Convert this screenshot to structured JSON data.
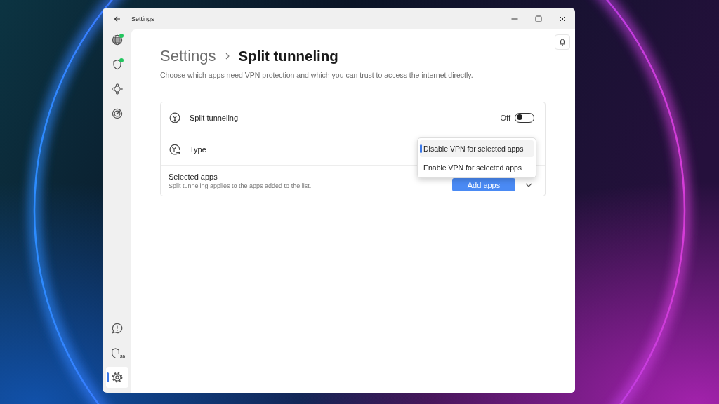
{
  "window": {
    "title": "Settings"
  },
  "sidebar": {
    "items": [
      {
        "kind": "globe",
        "indicator": true,
        "selected": false
      },
      {
        "kind": "shield",
        "indicator": true,
        "selected": false
      },
      {
        "kind": "nodes",
        "indicator": false,
        "selected": false
      },
      {
        "kind": "target",
        "indicator": false,
        "selected": false
      }
    ],
    "bottom_items": [
      {
        "kind": "help",
        "indicator": false,
        "selected": false
      },
      {
        "kind": "shield",
        "indicator": false,
        "badge": "80",
        "selected": false
      },
      {
        "kind": "settings",
        "indicator": false,
        "selected": true
      }
    ]
  },
  "header": {
    "breadcrumb": [
      "Settings",
      "Split tunneling"
    ],
    "description": "Choose which apps need VPN protection and which you can trust to access the internet directly."
  },
  "split_tunneling_card": {
    "rows": [
      {
        "kind": "toggle",
        "label": "Split tunneling",
        "state_label": "Off",
        "on": false
      },
      {
        "kind": "dropdown",
        "label": "Type",
        "expanded": true,
        "options": [
          {
            "label": "Disable VPN for selected apps",
            "selected": true
          },
          {
            "label": "Enable VPN for selected apps",
            "selected": false
          }
        ]
      },
      {
        "kind": "apps",
        "label": "Selected apps",
        "description": "Split tunneling applies to the apps added to the list.",
        "button": "Add apps",
        "expanded": false
      }
    ]
  }
}
